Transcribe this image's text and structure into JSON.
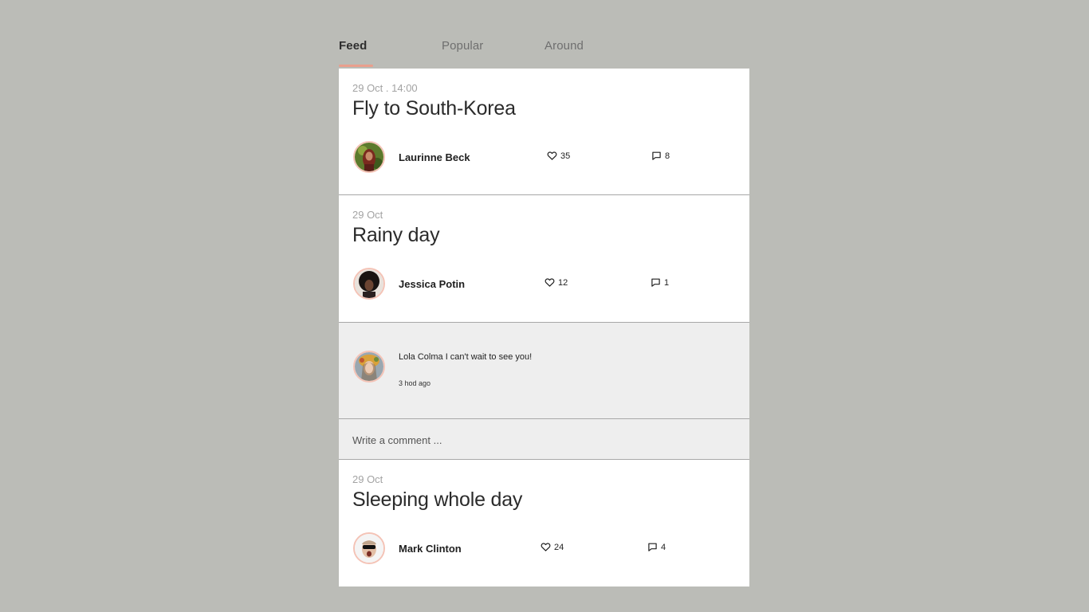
{
  "tabs": [
    {
      "label": "Feed",
      "active": true
    },
    {
      "label": "Popular",
      "active": false
    },
    {
      "label": "Around",
      "active": false
    }
  ],
  "accent_color": "#f19a86",
  "posts": [
    {
      "date": "29 Oct . 14:00",
      "title": "Fly to South-Korea",
      "author": "Laurinne Beck",
      "likes": "35",
      "comments": "8"
    },
    {
      "date": "29 Oct",
      "title": "Rainy day",
      "author": "Jessica Potin",
      "likes": "12",
      "comments": "1"
    },
    {
      "date": "29 Oct",
      "title": "Sleeping whole day",
      "author": "Mark Clinton",
      "likes": "24",
      "comments": "4"
    }
  ],
  "comment": {
    "author": "Lola Colma",
    "text": "Lola Colma I can't wait to see you!",
    "time": "3 hod ago"
  },
  "write_comment": {
    "placeholder": "Write a comment ..."
  },
  "icons": {
    "like": "heart-icon",
    "comment": "speech-bubble-icon"
  }
}
